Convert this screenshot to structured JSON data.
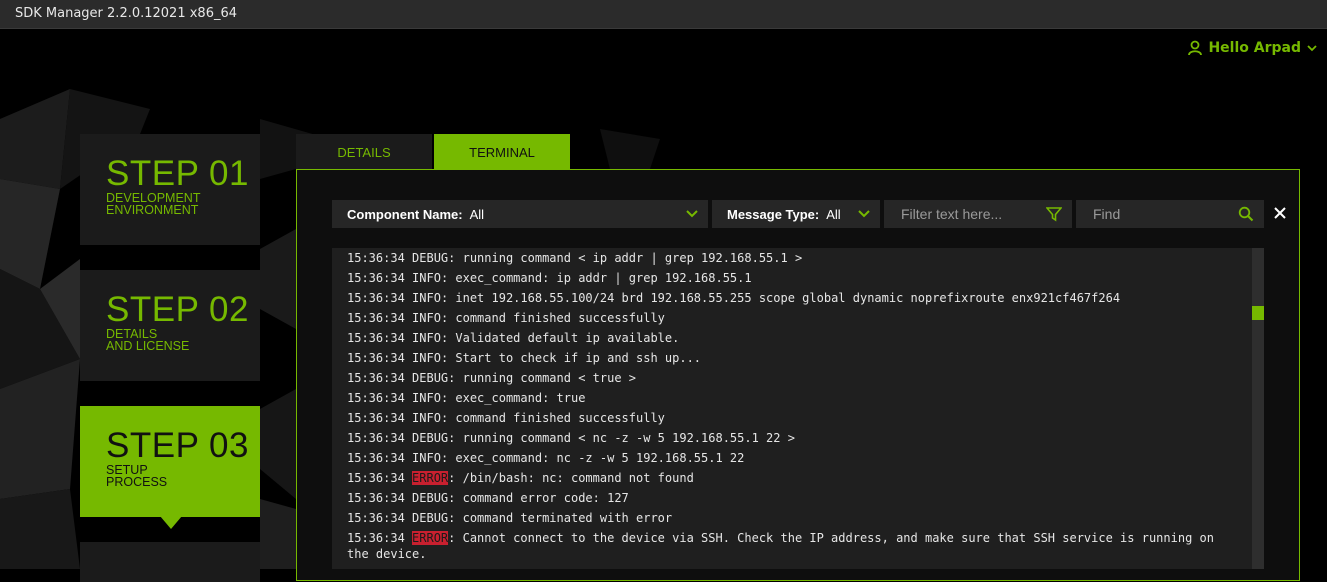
{
  "window": {
    "title": "SDK Manager 2.2.0.12021 x86_64"
  },
  "user": {
    "greeting": "Hello Arpad",
    "icon": "user-icon"
  },
  "steps": [
    {
      "number": "STEP 01",
      "line1": "DEVELOPMENT",
      "line2": "ENVIRONMENT",
      "active": false
    },
    {
      "number": "STEP 02",
      "line1": "DETAILS",
      "line2": "AND LICENSE",
      "active": false
    },
    {
      "number": "STEP 03",
      "line1": "SETUP",
      "line2": "PROCESS",
      "active": true
    }
  ],
  "tabs": {
    "details": "DETAILS",
    "terminal": "TERMINAL",
    "selected": "TERMINAL"
  },
  "filters": {
    "component_label": "Component Name:",
    "component_value": "All",
    "message_label": "Message Type:",
    "message_value": "All",
    "text_placeholder": "Filter text here...",
    "find_placeholder": "Find"
  },
  "colors": {
    "accent": "#76b900",
    "error": "#c8202f",
    "panel": "#1f1f1f"
  },
  "log": [
    {
      "time": "15:36:34",
      "level": "DEBUG",
      "msg": ": running command < ip addr | grep 192.168.55.1 >"
    },
    {
      "time": "15:36:34",
      "level": "INFO",
      "msg": ": exec_command: ip addr | grep 192.168.55.1"
    },
    {
      "time": "15:36:34",
      "level": "INFO",
      "msg": ": inet 192.168.55.100/24 brd 192.168.55.255 scope global dynamic noprefixroute enx921cf467f264"
    },
    {
      "time": "15:36:34",
      "level": "INFO",
      "msg": ": command finished successfully"
    },
    {
      "time": "15:36:34",
      "level": "INFO",
      "msg": ": Validated default ip available."
    },
    {
      "time": "15:36:34",
      "level": "INFO",
      "msg": ": Start to check if ip and ssh up..."
    },
    {
      "time": "15:36:34",
      "level": "DEBUG",
      "msg": ": running command < true >"
    },
    {
      "time": "15:36:34",
      "level": "INFO",
      "msg": ": exec_command: true"
    },
    {
      "time": "15:36:34",
      "level": "INFO",
      "msg": ": command finished successfully"
    },
    {
      "time": "15:36:34",
      "level": "DEBUG",
      "msg": ": running command < nc -z -w 5 192.168.55.1 22 >"
    },
    {
      "time": "15:36:34",
      "level": "INFO",
      "msg": ": exec_command: nc -z -w 5 192.168.55.1 22"
    },
    {
      "time": "15:36:34",
      "level": "ERROR",
      "msg": ": /bin/bash: nc: command not found"
    },
    {
      "time": "15:36:34",
      "level": "DEBUG",
      "msg": ": command error code: 127"
    },
    {
      "time": "15:36:34",
      "level": "DEBUG",
      "msg": ": command terminated with error"
    },
    {
      "time": "15:36:34",
      "level": "ERROR",
      "msg": ": Cannot connect to the device via SSH. Check the IP address, and make sure that SSH service is running on the device."
    }
  ]
}
